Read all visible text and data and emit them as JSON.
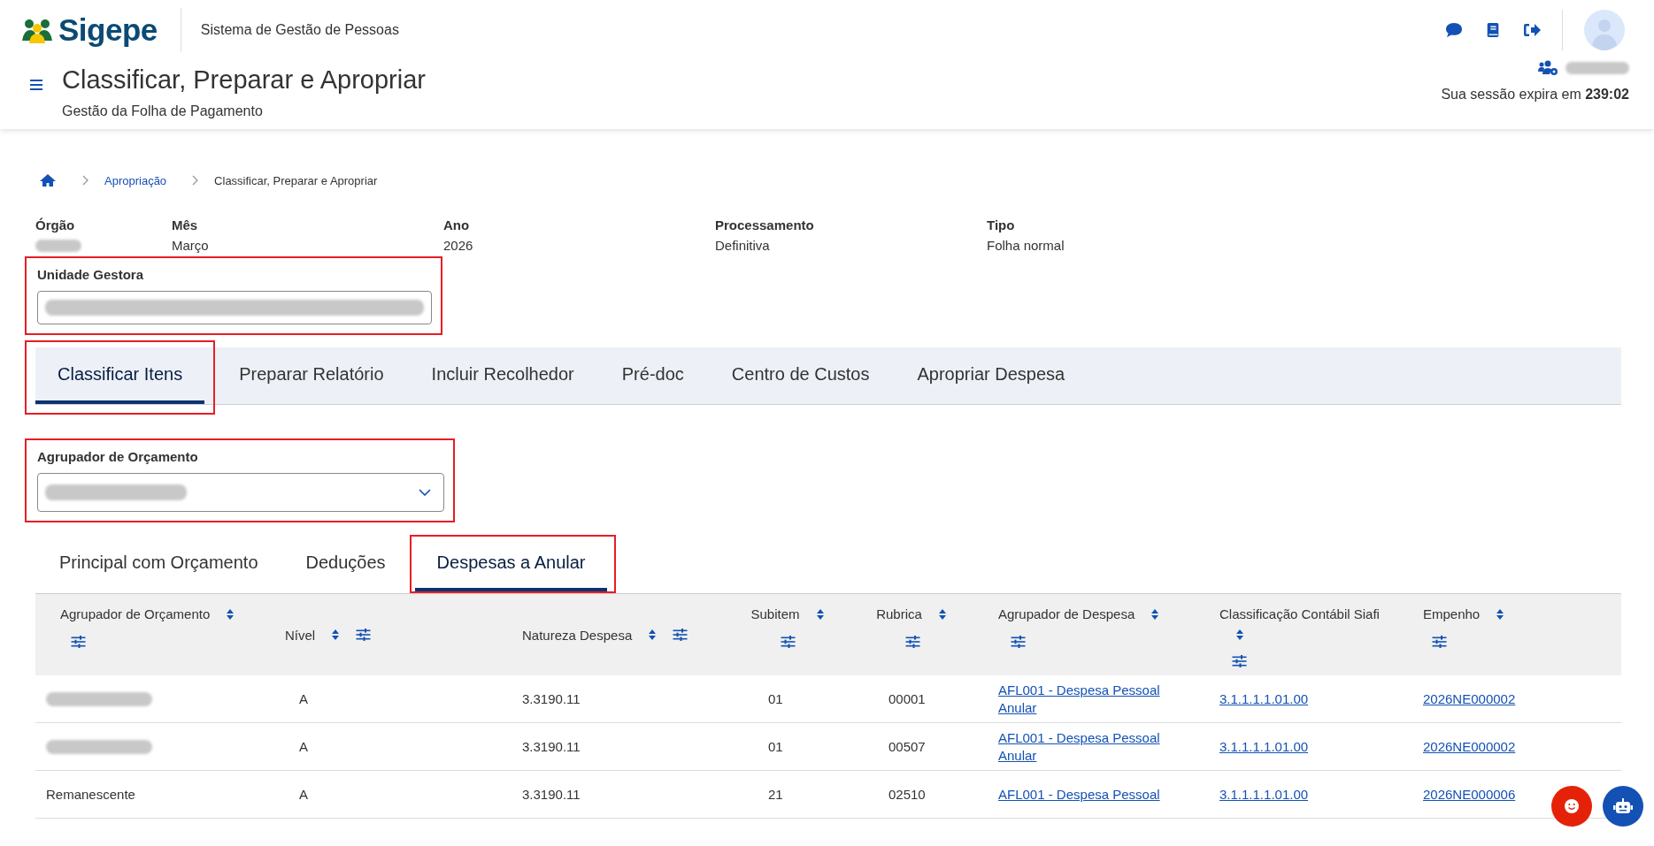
{
  "header": {
    "logo_text": "Sigepe",
    "system_name": "Sistema de Gestão de Pessoas",
    "page_title": "Classificar, Preparar e Apropriar",
    "page_subtitle": "Gestão da Folha de Pagamento",
    "user_redacted": true,
    "session_label": "Sua sessão expira em",
    "session_time": "239:02"
  },
  "breadcrumb": [
    {
      "label": "Apropriação",
      "link": true
    },
    {
      "label": "Classificar, Preparar e Apropriar",
      "link": false
    }
  ],
  "summary": [
    {
      "label": "Órgão",
      "kind": "redacted"
    },
    {
      "label": "Mês",
      "kind": "text",
      "value": "Março"
    },
    {
      "label": "Ano",
      "kind": "text",
      "value": "2026"
    },
    {
      "label": "Processamento",
      "kind": "text",
      "value": "Definitiva"
    },
    {
      "label": "Tipo",
      "kind": "text",
      "value": "Folha normal"
    }
  ],
  "unidade_gestora": {
    "label": "Unidade Gestora",
    "redacted": true,
    "highlighted": true
  },
  "main_tabs": [
    {
      "label": "Classificar Itens",
      "selected": true,
      "highlighted": true
    },
    {
      "label": "Preparar Relatório",
      "selected": false,
      "highlighted": false
    },
    {
      "label": "Incluir Recolhedor",
      "selected": false,
      "highlighted": false
    },
    {
      "label": "Pré-doc",
      "selected": false,
      "highlighted": false
    },
    {
      "label": "Centro de Custos",
      "selected": false,
      "highlighted": false
    },
    {
      "label": "Apropriar Despesa",
      "selected": false,
      "highlighted": false
    }
  ],
  "agrupador": {
    "label": "Agrupador de Orçamento",
    "redacted": true,
    "highlighted": true
  },
  "sub_tabs": [
    {
      "label": "Principal com Orçamento",
      "selected": false,
      "highlighted": false
    },
    {
      "label": "Deduções",
      "selected": false,
      "highlighted": false
    },
    {
      "label": "Despesas a Anular",
      "selected": true,
      "highlighted": true
    }
  ],
  "table": {
    "columns": [
      {
        "label": "Agrupador de Orçamento"
      },
      {
        "label": "Nível"
      },
      {
        "label": "Natureza Despesa"
      },
      {
        "label": "Subitem"
      },
      {
        "label": "Rubrica"
      },
      {
        "label": "Agrupador de Despesa"
      },
      {
        "label": "Classificação Contábil Siafi"
      },
      {
        "label": "Empenho"
      }
    ],
    "rows": [
      {
        "cells": [
          {
            "kind": "redacted"
          },
          {
            "kind": "text",
            "text": "A"
          },
          {
            "kind": "text",
            "text": "3.3190.11"
          },
          {
            "kind": "text",
            "text": "01"
          },
          {
            "kind": "text",
            "text": "00001"
          },
          {
            "kind": "link",
            "text": "AFL001 - Despesa Pessoal Anular"
          },
          {
            "kind": "link",
            "text": "3.1.1.1.1.01.00"
          },
          {
            "kind": "link",
            "text": "2026NE000002"
          }
        ]
      },
      {
        "cells": [
          {
            "kind": "redacted"
          },
          {
            "kind": "text",
            "text": "A"
          },
          {
            "kind": "text",
            "text": "3.3190.11"
          },
          {
            "kind": "text",
            "text": "01"
          },
          {
            "kind": "text",
            "text": "00507"
          },
          {
            "kind": "link",
            "text": "AFL001 - Despesa Pessoal Anular"
          },
          {
            "kind": "link",
            "text": "3.1.1.1.1.01.00"
          },
          {
            "kind": "link",
            "text": "2026NE000002"
          }
        ]
      },
      {
        "cells": [
          {
            "kind": "text",
            "text": "Remanescente"
          },
          {
            "kind": "text",
            "text": "A"
          },
          {
            "kind": "text",
            "text": "3.3190.11"
          },
          {
            "kind": "text",
            "text": "21"
          },
          {
            "kind": "text",
            "text": "02510"
          },
          {
            "kind": "link",
            "text": "AFL001 - Despesa Pessoal"
          },
          {
            "kind": "link",
            "text": "3.1.1.1.1.01.00"
          },
          {
            "kind": "link",
            "text": "2026NE000006"
          }
        ]
      }
    ]
  }
}
